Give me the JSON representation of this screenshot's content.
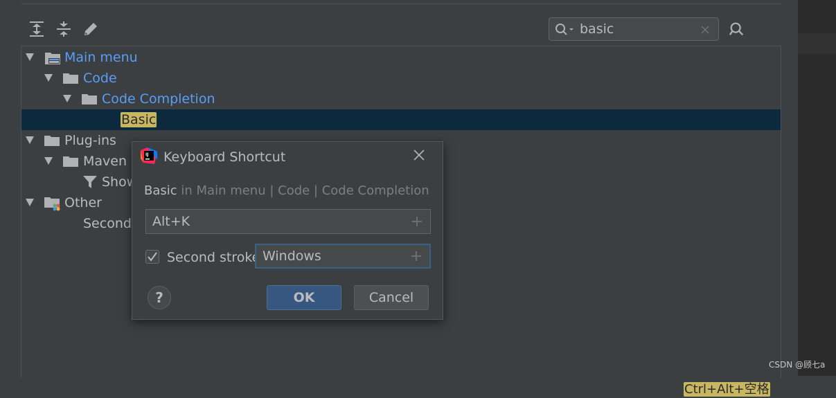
{
  "search": {
    "value": "basic"
  },
  "icons": {
    "expand_all": "expand-all-icon",
    "collapse_all": "collapse-all-icon",
    "edit": "edit-icon",
    "search": "search-icon",
    "clear": "close-icon",
    "find_usages": "find-usages-icon"
  },
  "tree": {
    "main_menu": "Main menu",
    "code": "Code",
    "code_completion": "Code Completion",
    "basic": "Basic",
    "plugins": "Plug-ins",
    "maven": "Maven",
    "show": "Show",
    "other": "Other",
    "second": "Second",
    "shortcut": "Ctrl+Alt+空格"
  },
  "dialog": {
    "title": "Keyboard Shortcut",
    "action": "Basic",
    "path": " in Main menu | Code | Code Completion",
    "first_stroke": "Alt+K",
    "second_stroke_label": "Second stroke:",
    "second_stroke_checked": true,
    "second_stroke": "Windows",
    "help": "?",
    "ok": "OK",
    "cancel": "Cancel"
  },
  "colors": {
    "background": "#3c3f41",
    "selection": "#0d293e",
    "highlight": "#c9b661",
    "link_blue": "#589df6",
    "ok_button": "#365880"
  },
  "watermark": "CSDN @顾七a"
}
